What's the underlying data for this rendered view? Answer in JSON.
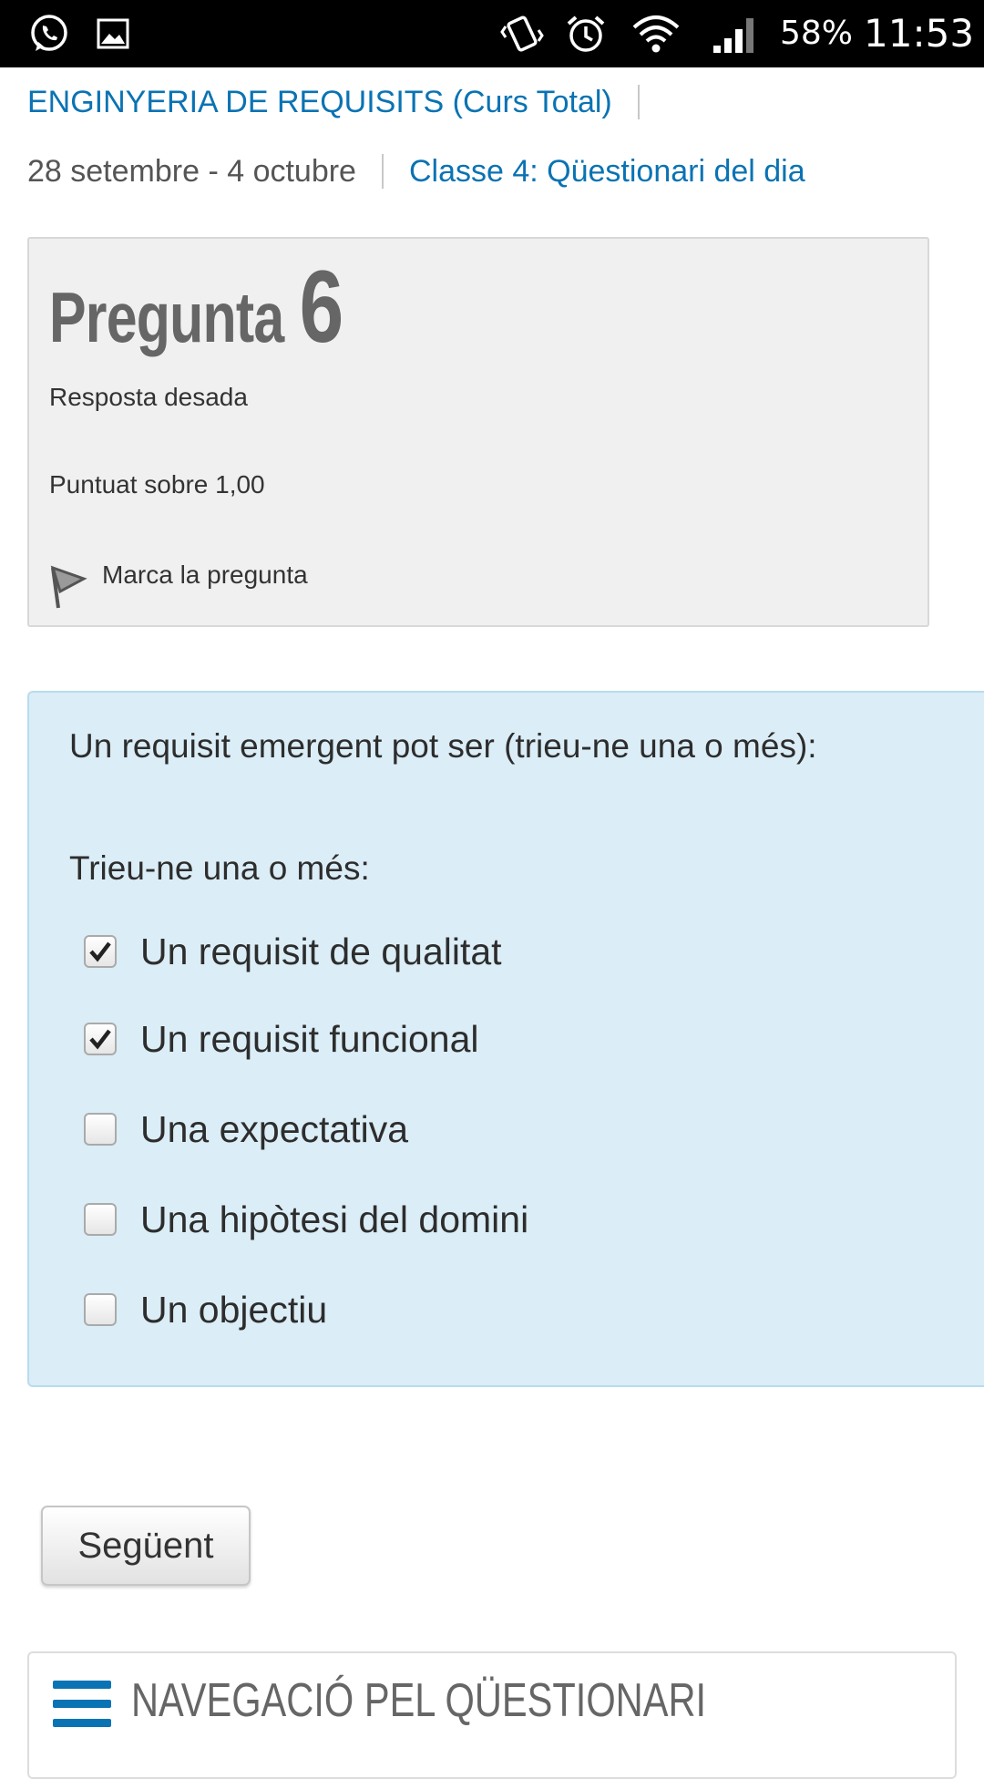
{
  "status_bar": {
    "battery": "58%",
    "time": "11:53",
    "icons": [
      "whatsapp-icon",
      "gallery-icon",
      "vibrate-icon",
      "alarm-icon",
      "wifi-icon",
      "signal-icon"
    ]
  },
  "breadcrumb": {
    "course": "ENGINYERIA DE REQUISITS (Curs Total)",
    "week": "28 setembre - 4 octubre",
    "activity": "Classe 4: Qüestionari del dia"
  },
  "question_info": {
    "label": "Pregunta",
    "number": "6",
    "state": "Resposta desada",
    "grade": "Puntuat sobre 1,00",
    "flag_label": "Marca la pregunta"
  },
  "question": {
    "text": "Un requisit emergent pot ser (trieu-ne una o més):",
    "prompt": "Trieu-ne una o més:",
    "options": [
      {
        "label": "Un requisit de qualitat",
        "checked": true
      },
      {
        "label": "Un requisit funcional",
        "checked": true
      },
      {
        "label": "Una expectativa",
        "checked": false
      },
      {
        "label": "Una hipòtesi del domini",
        "checked": false
      },
      {
        "label": "Un objectiu",
        "checked": false
      }
    ]
  },
  "next_button": "Següent",
  "nav_block": {
    "title": "NAVEGACIÓ PEL QÜESTIONARI"
  },
  "colors": {
    "link": "#0a73b3",
    "question_bg": "#dbedf6",
    "info_bg": "#f0f0f0"
  }
}
